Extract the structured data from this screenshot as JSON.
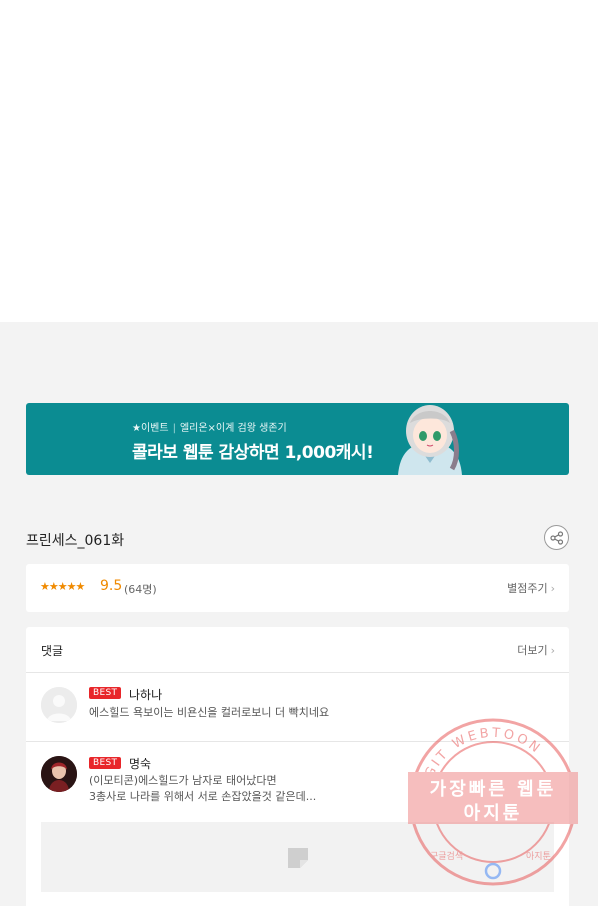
{
  "banner": {
    "event_label": "★이벤트",
    "event_desc": "엘리온×이계 검왕 생존기",
    "headline": "콜라보 웹툰 감상하면 1,000캐시!"
  },
  "episode": {
    "title": "프린세스_061화"
  },
  "rating": {
    "stars": "★★★★★",
    "score": "9.5",
    "count": "(64명)",
    "rate_button": "별점주기"
  },
  "comments": {
    "label": "댓글",
    "more": "더보기",
    "items": [
      {
        "badge": "BEST",
        "nick": "나하나",
        "text": "에스힐드 욕보이는 비욘신을 컬러로보니 더 빡치네요"
      },
      {
        "badge": "BEST",
        "nick": "명숙",
        "text_line1": "(이모티콘)에스힐드가 남자로 태어났다면",
        "text_line2": "3총사로 나라를 위해서 서로 손잡았을것 같은데..."
      }
    ]
  },
  "watermark": {
    "ring_text": "AGIT WEBTOON",
    "line1": "가장빠른 웹툰",
    "line2": "아지툰",
    "bottom_left": "구글검색",
    "bottom_right": "아지툰"
  },
  "colors": {
    "banner_bg": "#0b8c92",
    "best_badge": "#e8262a",
    "rating_orange": "#f08a00",
    "watermark": "#e85a5a"
  }
}
